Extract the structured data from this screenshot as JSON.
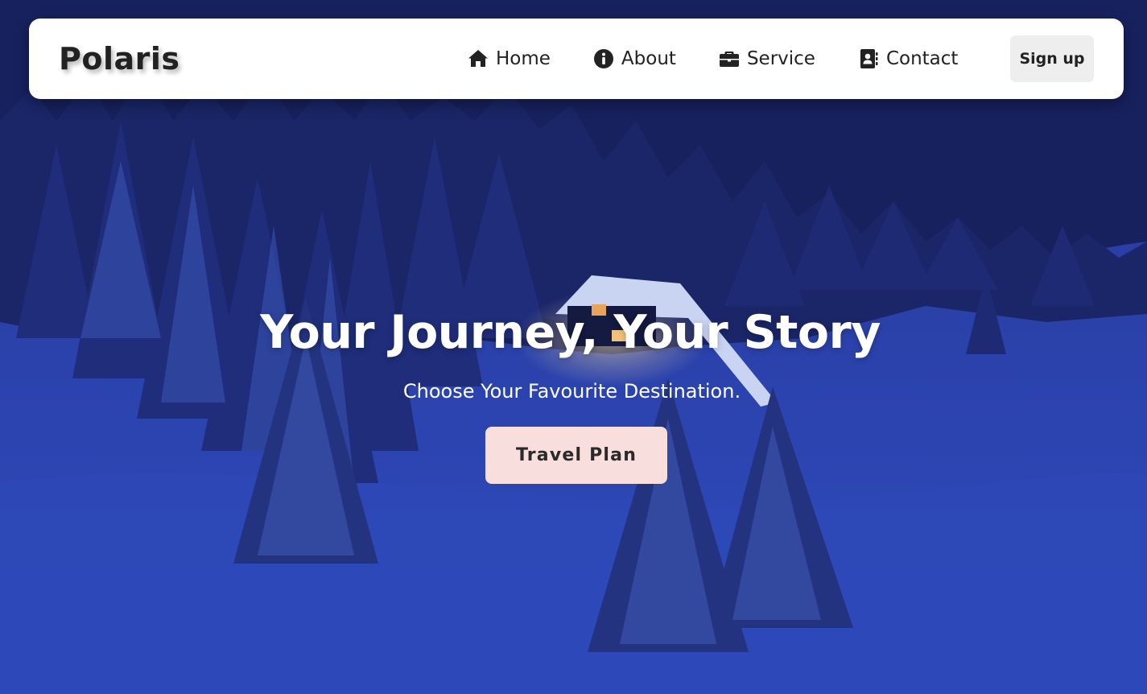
{
  "brand": {
    "name": "Polaris"
  },
  "nav": {
    "items": [
      {
        "label": "Home",
        "icon": "home-icon"
      },
      {
        "label": "About",
        "icon": "info-circle-icon"
      },
      {
        "label": "Service",
        "icon": "briefcase-icon"
      },
      {
        "label": "Contact",
        "icon": "address-book-icon"
      }
    ],
    "signup_label": "Sign up"
  },
  "hero": {
    "title": "Your Journey, Your Story",
    "subtitle": "Choose Your Favourite Destination.",
    "cta_label": "Travel Plan"
  },
  "colors": {
    "navbar_bg": "#ffffff",
    "text_dark": "#222222",
    "signup_bg": "#eeeeee",
    "cta_bg": "#f8dedd",
    "hero_text": "#ffffff",
    "night_sky": "#15205c",
    "snow_blue": "#2c47b5"
  }
}
